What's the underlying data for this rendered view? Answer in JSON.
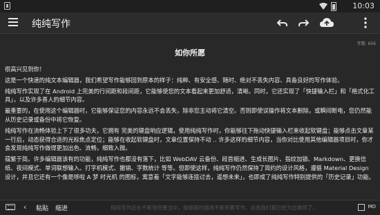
{
  "status": {
    "time": "10:03"
  },
  "toolbar": {
    "title": "纯纯写作",
    "icons": [
      "menu-icon",
      "undo-icon",
      "redo-icon",
      "cloud-upload-icon",
      "more-vert-icon"
    ]
  },
  "editor": {
    "word_count": "字数: 656",
    "doc_title": "如你所愿",
    "paragraphs": [
      "很高兴见到你！",
      "这是一个快速的纯文本编辑器，我们希望写作能够回到原本的样子：纯粹、有安全感、随时、绝对不丢失内容、具备良好的写作体验。",
      "纯纯写作实现了在 Android 上完美的行间距和段间距，它能够使您的文本看起来更加舒适，清晰。同时，它还实现了「快捷输入栏」和「格式化工具」，以及许多喜人的细节内容。",
      "最重要的，在使用这个编辑器时，它能够保证您的内容永远不会丢失，除非您主动将它清空。否则即使误操作将文本删除，或瞬间断电，您仍然能从历史记录或备份中将它恢复。",
      "纯纯写作在流畅体验上下了很多功夫，它拥有 完美的键盘响应逻辑，使用纯纯写作时，你能够往下拖动快捷输入栏来收起软键盘；能够点击文章某一行后，动态获得合适的光标焦点定位；能够在收起软键盘时，文章位置保持不动 .. 许多这样的细节内容，当你对比使用其他编辑器项目时，你才会发现纯纯写作做得更加出色、流畅，细致入微。",
      "蕴繁于简。许多编辑器该有的功能，纯纯写作也都没有落下，比如 WebDAV 云备份、段首缩进、生成长图片、指纹加锁、Markdown、更换信纸、夜间模式、单词联想输入、打字机模式、撤销、字数统计 等等。但即使这样，纯纯写作仍然保持了简约的设计风格，遵循 Material Design 设计，并且它还有一个像是哆啦 A 梦 时光机 的图标，寓意着「文字能够连接过去，遥想未来」，也即成了纯纯写作特别提供的「历史记录」功能。"
    ]
  },
  "bottom_bar": {
    "paste_label": "粘贴",
    "indent_label": "缩进",
    "hint_text": "纯纯写作还在不断地完善当中，能够随时随地不断积累写作。这些我们都已经为您做到了。",
    "md_label": "MD"
  }
}
